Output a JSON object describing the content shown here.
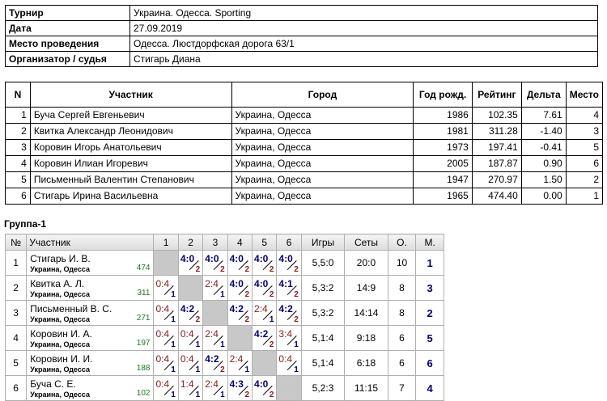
{
  "info": {
    "rows": [
      {
        "key": "Турнир",
        "value": "Украина. Одесса. Sporting"
      },
      {
        "key": "Дата",
        "value": "27.09.2019"
      },
      {
        "key": "Место проведения",
        "value": "Одесса. Люстдорфская дорога 63/1"
      },
      {
        "key": "Организатор / судья",
        "value": "Стигарь Диана"
      }
    ]
  },
  "participants": {
    "headers": {
      "n": "N",
      "name": "Участник",
      "city": "Город",
      "year": "Год рожд.",
      "rating": "Рейтинг",
      "delta": "Дельта",
      "place": "Место"
    },
    "rows": [
      {
        "n": "1",
        "name": "Буча Сергей Евгеньевич",
        "city": "Украина, Одесса",
        "year": "1986",
        "rating": "102.35",
        "delta": "7.61",
        "place": "4"
      },
      {
        "n": "2",
        "name": "Квитка Александр Леонидович",
        "city": "Украина, Одесса",
        "year": "1981",
        "rating": "311.28",
        "delta": "-1.40",
        "place": "3"
      },
      {
        "n": "3",
        "name": "Коровин Игорь Анатольевич",
        "city": "Украина, Одесса",
        "year": "1973",
        "rating": "197.41",
        "delta": "-0.41",
        "place": "5"
      },
      {
        "n": "4",
        "name": "Коровин Илиан Игоревич",
        "city": "Украина, Одесса",
        "year": "2005",
        "rating": "187.87",
        "delta": "0.90",
        "place": "6"
      },
      {
        "n": "5",
        "name": "Письменный Валентин Степанович",
        "city": "Украина, Одесса",
        "year": "1947",
        "rating": "270.97",
        "delta": "1.50",
        "place": "2"
      },
      {
        "n": "6",
        "name": "Стигарь Ирина Васильевна",
        "city": "Украина, Одесса",
        "year": "1965",
        "rating": "474.40",
        "delta": "0.00",
        "place": "1"
      }
    ]
  },
  "group": {
    "title": "Группа-1",
    "headers": {
      "n": "№",
      "name": "Участник",
      "c1": "1",
      "c2": "2",
      "c3": "3",
      "c4": "4",
      "c5": "5",
      "c6": "6",
      "games": "Игры",
      "sets": "Сеты",
      "points": "О.",
      "place": "М."
    },
    "rows": [
      {
        "n": "1",
        "name": "Стигарь И. В.",
        "city": "Украина, Одесса",
        "rating": "474",
        "cells": [
          null,
          {
            "s": "4:0",
            "r": "2",
            "w": true
          },
          {
            "s": "4:0",
            "r": "2",
            "w": true
          },
          {
            "s": "4:0",
            "r": "2",
            "w": true
          },
          {
            "s": "4:0",
            "r": "2",
            "w": true
          },
          {
            "s": "4:0",
            "r": "2",
            "w": true
          }
        ],
        "games": "5,5:0",
        "sets": "20:0",
        "points": "10",
        "place": "1"
      },
      {
        "n": "2",
        "name": "Квитка А. Л.",
        "city": "Украина, Одесса",
        "rating": "311",
        "cells": [
          {
            "s": "0:4",
            "r": "1",
            "w": false
          },
          null,
          {
            "s": "2:4",
            "r": "1",
            "w": false
          },
          {
            "s": "4:0",
            "r": "2",
            "w": true
          },
          {
            "s": "4:0",
            "r": "2",
            "w": true
          },
          {
            "s": "4:1",
            "r": "2",
            "w": true
          }
        ],
        "games": "5,3:2",
        "sets": "14:9",
        "points": "8",
        "place": "3"
      },
      {
        "n": "3",
        "name": "Письменный В. С.",
        "city": "Украина, Одесса",
        "rating": "271",
        "cells": [
          {
            "s": "0:4",
            "r": "1",
            "w": false
          },
          {
            "s": "4:2",
            "r": "2",
            "w": true
          },
          null,
          {
            "s": "4:2",
            "r": "2",
            "w": true
          },
          {
            "s": "2:4",
            "r": "1",
            "w": false
          },
          {
            "s": "4:2",
            "r": "2",
            "w": true
          }
        ],
        "games": "5,3:2",
        "sets": "14:14",
        "points": "8",
        "place": "2"
      },
      {
        "n": "4",
        "name": "Коровин И. А.",
        "city": "Украина, Одесса",
        "rating": "197",
        "cells": [
          {
            "s": "0:4",
            "r": "1",
            "w": false
          },
          {
            "s": "0:4",
            "r": "1",
            "w": false
          },
          {
            "s": "2:4",
            "r": "1",
            "w": false
          },
          null,
          {
            "s": "4:2",
            "r": "2",
            "w": true
          },
          {
            "s": "3:4",
            "r": "1",
            "w": false
          }
        ],
        "games": "5,1:4",
        "sets": "9:18",
        "points": "6",
        "place": "5"
      },
      {
        "n": "5",
        "name": "Коровин И. И.",
        "city": "Украина, Одесса",
        "rating": "188",
        "cells": [
          {
            "s": "0:4",
            "r": "1",
            "w": false
          },
          {
            "s": "0:4",
            "r": "1",
            "w": false
          },
          {
            "s": "4:2",
            "r": "2",
            "w": true
          },
          {
            "s": "2:4",
            "r": "1",
            "w": false
          },
          null,
          {
            "s": "0:4",
            "r": "1",
            "w": false
          }
        ],
        "games": "5,1:4",
        "sets": "6:18",
        "points": "6",
        "place": "6"
      },
      {
        "n": "6",
        "name": "Буча С. Е.",
        "city": "Украина, Одесса",
        "rating": "102",
        "cells": [
          {
            "s": "0:4",
            "r": "1",
            "w": false
          },
          {
            "s": "1:4",
            "r": "1",
            "w": false
          },
          {
            "s": "2:4",
            "r": "1",
            "w": false
          },
          {
            "s": "4:3",
            "r": "2",
            "w": true
          },
          {
            "s": "4:0",
            "r": "2",
            "w": true
          },
          null
        ],
        "games": "5,2:3",
        "sets": "11:15",
        "points": "7",
        "place": "4"
      }
    ]
  }
}
